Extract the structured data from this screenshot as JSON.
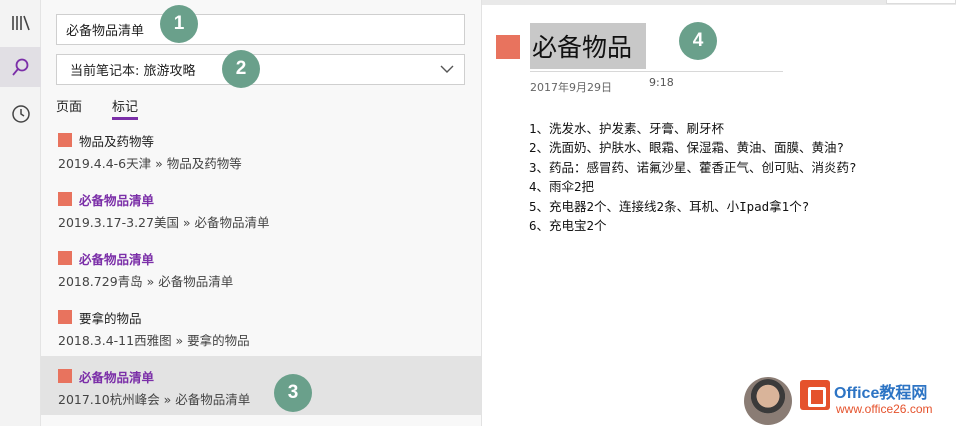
{
  "rail": {
    "items": [
      {
        "icon": "notebooks-icon"
      },
      {
        "icon": "search-icon"
      },
      {
        "icon": "recent-icon"
      }
    ]
  },
  "search": {
    "query": "必备物品清单",
    "scope": "当前笔记本: 旅游攻略",
    "tabs": [
      {
        "label": "页面"
      },
      {
        "label": "标记"
      }
    ],
    "results": [
      {
        "title": "物品及药物等",
        "path": "2019.4.4-6天津 » 物品及药物等"
      },
      {
        "title": "必备物品清单",
        "path": "2019.3.17-3.27美国 » 必备物品清单"
      },
      {
        "title": "必备物品清单",
        "path": "2018.729青岛 » 必备物品清单"
      },
      {
        "title": "要拿的物品",
        "path": "2018.3.4-11西雅图 » 要拿的物品"
      },
      {
        "title": "必备物品清单",
        "path": "2017.10杭州峰会 » 必备物品清单"
      }
    ]
  },
  "note": {
    "title": "必备物品",
    "date": "2017年9月29日",
    "time": "9:18",
    "lines": [
      "1、洗发水、护发素、牙膏、刷牙杯",
      "2、洗面奶、护肤水、眼霜、保湿霜、黄油、面膜、黄油?",
      "3、药品：感冒药、诺氟沙星、藿香正气、创可贴、消炎药?",
      "4、雨伞2把",
      "5、充电器2个、连接线2条、耳机、小Ipad拿1个?",
      "6、充电宝2个"
    ]
  },
  "callouts": [
    "1",
    "2",
    "3",
    "4"
  ],
  "watermark": {
    "name": "Office教程网",
    "url": "www.office26.com"
  },
  "colors": {
    "accent": "#7b2fa8",
    "tag": "#e8735e",
    "callout": "#6aa08b"
  }
}
